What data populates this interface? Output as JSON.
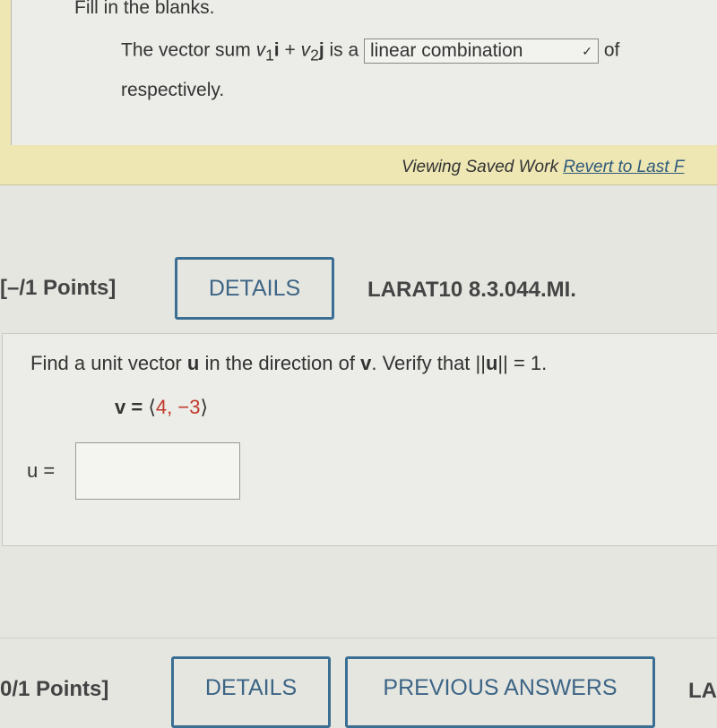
{
  "prev_question": {
    "instruction": "Fill in the blanks.",
    "sentence_start": "The vector sum ",
    "v": "v",
    "sub1": "1",
    "i": "i",
    "plus": " + ",
    "sub2": "2",
    "j": "j",
    "is_a": " is a ",
    "select_value": "linear combination",
    "of": "of",
    "continuation": "respectively."
  },
  "saved_bar": {
    "viewing": "Viewing Saved Work",
    "revert_link": "Revert to Last F"
  },
  "question": {
    "points": "[–/1 Points]",
    "details_label": "DETAILS",
    "code": "LARAT10 8.3.044.MI.",
    "prompt_1": "Find a unit vector ",
    "u": "u",
    "prompt_2": " in the direction of ",
    "v": "v",
    "prompt_3": ". Verify that ||",
    "prompt_4": "|| = 1.",
    "given_label": "v = ",
    "given_open": "⟨",
    "given_values": "4, −3",
    "given_close": "⟩",
    "answer_label": "u =",
    "answer_value": ""
  },
  "next_question": {
    "points": "0/1 Points]",
    "details_label": "DETAILS",
    "previous_answers_label": "PREVIOUS ANSWERS",
    "code": "LA"
  },
  "colors": {
    "accent": "#3b6e93",
    "given_value": "#c0392b",
    "saved_bar": "#eee7b4"
  }
}
